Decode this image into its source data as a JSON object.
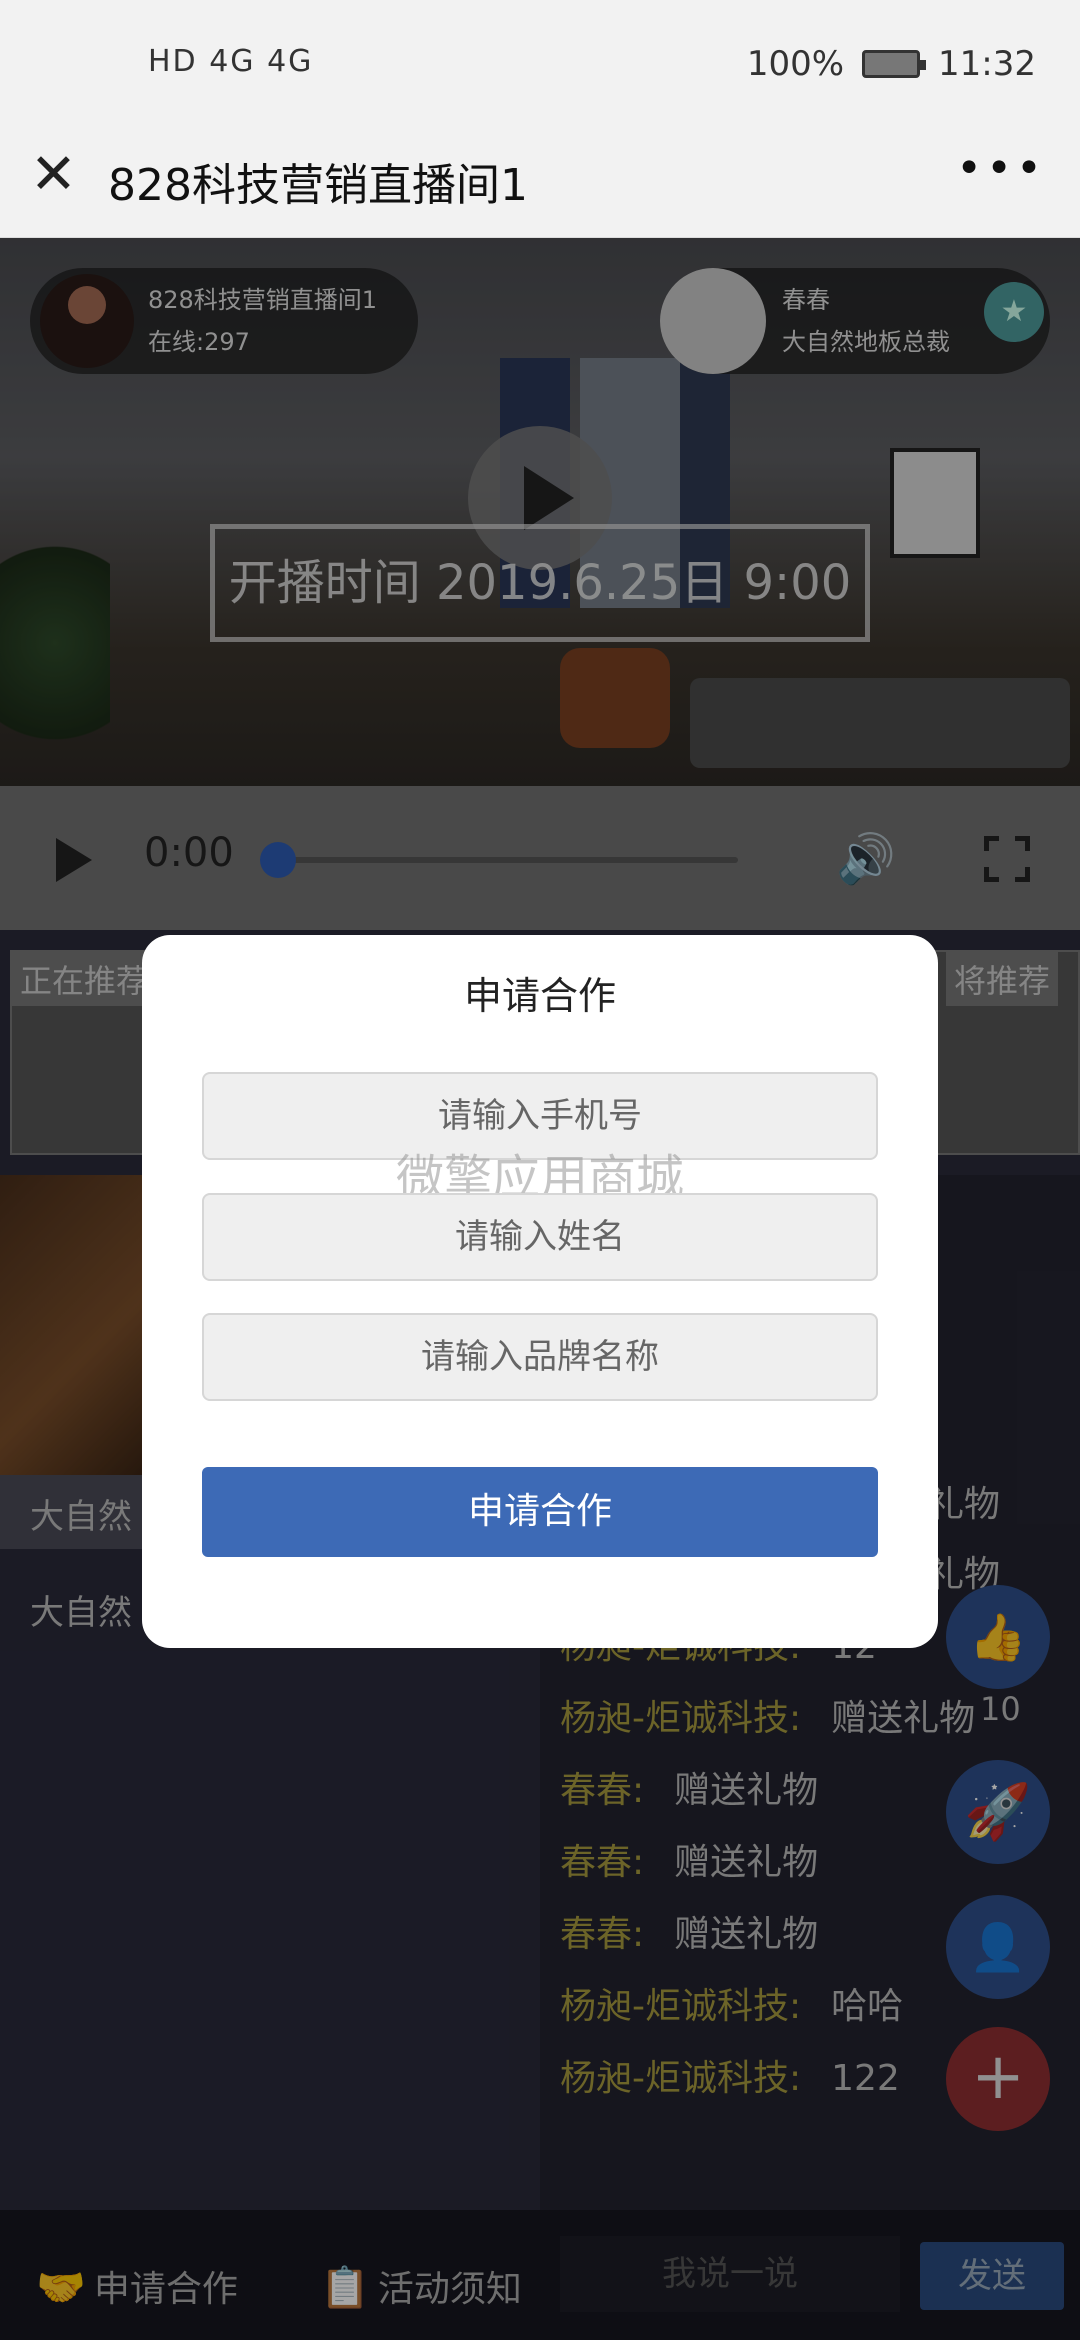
{
  "status_bar": {
    "left_icons": "HD 4G 4G",
    "battery": "100%",
    "time": "11:32"
  },
  "header": {
    "title": "828科技营销直播间1",
    "more": "•••",
    "close": "✕"
  },
  "host": {
    "name": "828科技营销直播间1",
    "online": "在线:297"
  },
  "guest": {
    "name": "春春",
    "title": "大自然地板总裁"
  },
  "video": {
    "start_time": "开播时间 2019.6.25日 9:00"
  },
  "player": {
    "time": "0:00",
    "progress": 0.0
  },
  "recommend": {
    "left_label": "正在推荐",
    "right_label": "将推荐"
  },
  "product": {
    "caption": "大自然",
    "caption2": "大自然"
  },
  "chat": {
    "messages": [
      {
        "who": "",
        "text": "礼物"
      },
      {
        "who": "",
        "text": "礼物"
      },
      {
        "who": "杨昶-炬诚科技:",
        "text": "12"
      },
      {
        "who": "杨昶-炬诚科技:",
        "text": "赠送礼物"
      },
      {
        "who": "春春:",
        "text": "赠送礼物"
      },
      {
        "who": "春春:",
        "text": "赠送礼物"
      },
      {
        "who": "春春:",
        "text": "赠送礼物"
      },
      {
        "who": "杨昶-炬诚科技:",
        "text": "哈哈"
      },
      {
        "who": "杨昶-炬诚科技:",
        "text": "122"
      }
    ]
  },
  "fabs": {
    "like_count": "10"
  },
  "bottom": {
    "apply": "申请合作",
    "notice": "活动须知",
    "input_placeholder": "我说一说",
    "send": "发送"
  },
  "modal": {
    "title": "申请合作",
    "phone_placeholder": "请输入手机号",
    "name_placeholder": "请输入姓名",
    "brand_placeholder": "请输入品牌名称",
    "watermark": "微擎应用商城",
    "submit": "申请合作"
  },
  "colors": {
    "accent": "#3d6ab6",
    "chat_name": "#a69a3e",
    "add_fab": "#8e2e32"
  }
}
